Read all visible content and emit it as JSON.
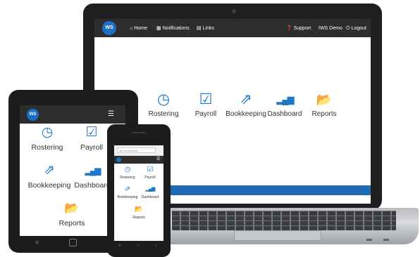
{
  "laptop": {
    "nav": {
      "logo_text": "WS",
      "left": [
        {
          "label": "Home",
          "icon": "home-icon",
          "glyph": "⌂"
        },
        {
          "label": "Notifications",
          "icon": "notifications-icon",
          "glyph": "▦"
        },
        {
          "label": "Links",
          "icon": "links-icon",
          "glyph": "▤"
        }
      ],
      "right": [
        {
          "label": "Support",
          "icon": "support-icon",
          "glyph": "❓"
        },
        {
          "label": "IWS Demo",
          "icon": "",
          "glyph": ""
        },
        {
          "label": "Logout",
          "icon": "power-icon",
          "glyph": "⏻"
        }
      ]
    },
    "tiles": [
      {
        "label": "Rostering",
        "icon": "clock-icon",
        "glyph": "◷"
      },
      {
        "label": "Payroll",
        "icon": "check-square-icon",
        "glyph": "☑"
      },
      {
        "label": "Bookkeeping",
        "icon": "share-square-icon",
        "glyph": "⇗"
      },
      {
        "label": "Dashboard",
        "icon": "signal-bars-icon",
        "glyph": "▂▄▆"
      },
      {
        "label": "Reports",
        "icon": "folder-open-icon",
        "glyph": "📂"
      }
    ],
    "accent_color": "#1f78c8",
    "footer_color": "#1f6bb5"
  },
  "tablet": {
    "logo_text": "WS",
    "menu_glyph": "☰",
    "tiles": [
      {
        "label": "Rostering",
        "glyph": "◷"
      },
      {
        "label": "Payroll",
        "glyph": "☑"
      },
      {
        "label": "Bookkeeping",
        "glyph": "⇗"
      },
      {
        "label": "Dashboard",
        "glyph": "▂▄▆"
      },
      {
        "label": "Reports",
        "glyph": "📂"
      }
    ],
    "nav_back_glyph": "≡"
  },
  "phone": {
    "url_text": "iws.com.au/home",
    "menu_glyph": "☰",
    "tiles": [
      {
        "label": "Rostering",
        "glyph": "◷"
      },
      {
        "label": "Payroll",
        "glyph": "☑"
      },
      {
        "label": "Bookkeeping",
        "glyph": "⇗"
      },
      {
        "label": "Dashboard",
        "glyph": "▂▄▆"
      },
      {
        "label": "Reports",
        "glyph": "📂"
      }
    ],
    "nav": [
      "≡",
      "○",
      "›"
    ]
  }
}
